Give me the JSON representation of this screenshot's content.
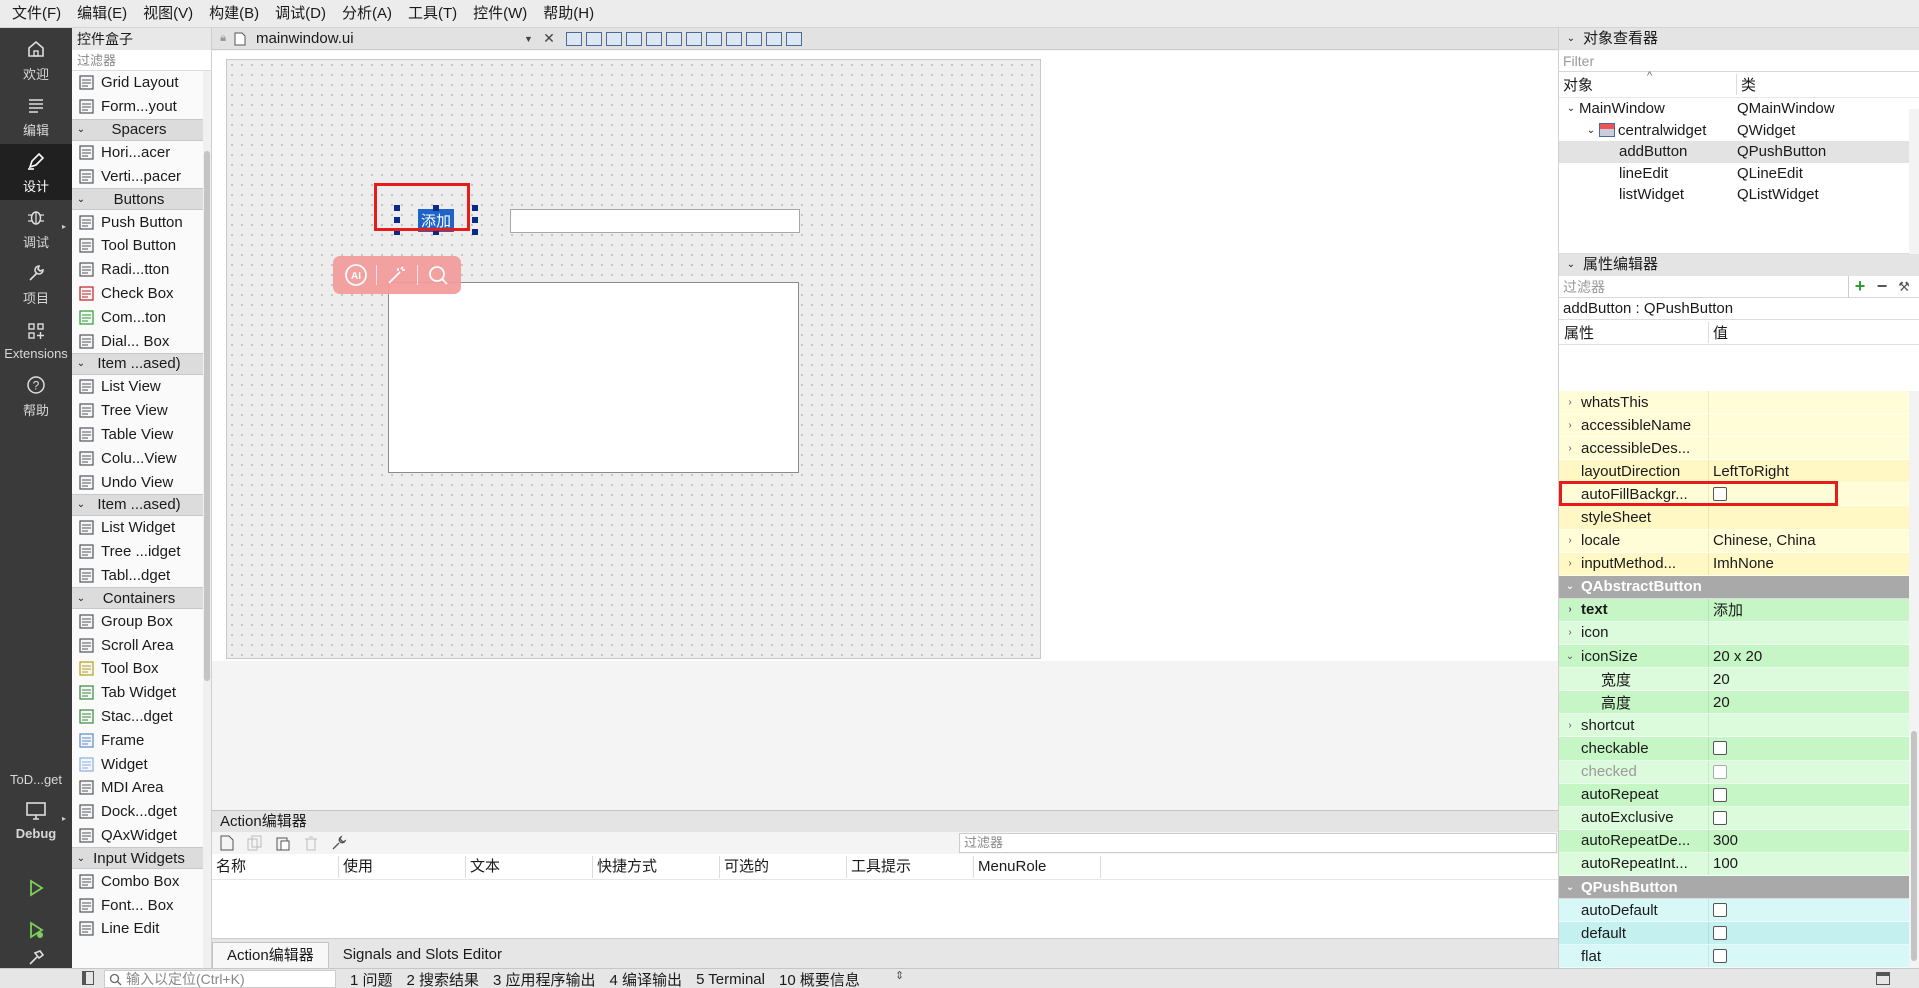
{
  "menu": [
    "文件(F)",
    "编辑(E)",
    "视图(V)",
    "构建(B)",
    "调试(D)",
    "分析(A)",
    "工具(T)",
    "控件(W)",
    "帮助(H)"
  ],
  "modes": {
    "welcome": "欢迎",
    "edit": "编辑",
    "design": "设计",
    "debug": "调试",
    "project": "项目",
    "extensions": "Extensions",
    "help": "帮助",
    "target_name": "ToD...get",
    "target_mode": "Debug"
  },
  "widgetbox": {
    "title": "控件盒子",
    "filter_placeholder": "过滤器",
    "items": [
      {
        "type": "item",
        "label": "Grid Layout",
        "icon": "grid-layout-icon"
      },
      {
        "type": "item",
        "label": "Form...yout",
        "icon": "form-layout-icon"
      },
      {
        "type": "cat",
        "label": "Spacers"
      },
      {
        "type": "item",
        "label": "Hori...acer",
        "icon": "horizontal-spacer-icon"
      },
      {
        "type": "item",
        "label": "Verti...pacer",
        "icon": "vertical-spacer-icon"
      },
      {
        "type": "cat",
        "label": "Buttons"
      },
      {
        "type": "item",
        "label": "Push Button",
        "icon": "push-button-icon"
      },
      {
        "type": "item",
        "label": "Tool Button",
        "icon": "tool-button-icon"
      },
      {
        "type": "item",
        "label": "Radi...tton",
        "icon": "radio-button-icon"
      },
      {
        "type": "item",
        "label": "Check Box",
        "icon": "check-box-icon"
      },
      {
        "type": "item",
        "label": "Com...ton",
        "icon": "command-link-icon"
      },
      {
        "type": "item",
        "label": "Dial... Box",
        "icon": "dialog-button-box-icon"
      },
      {
        "type": "cat",
        "label": "Item ...ased)"
      },
      {
        "type": "item",
        "label": "List View",
        "icon": "list-view-icon"
      },
      {
        "type": "item",
        "label": "Tree View",
        "icon": "tree-view-icon"
      },
      {
        "type": "item",
        "label": "Table View",
        "icon": "table-view-icon"
      },
      {
        "type": "item",
        "label": "Colu...View",
        "icon": "column-view-icon"
      },
      {
        "type": "item",
        "label": "Undo View",
        "icon": "undo-view-icon"
      },
      {
        "type": "cat",
        "label": "Item ...ased)"
      },
      {
        "type": "item",
        "label": "List Widget",
        "icon": "list-widget-icon"
      },
      {
        "type": "item",
        "label": "Tree ...idget",
        "icon": "tree-widget-icon"
      },
      {
        "type": "item",
        "label": "Tabl...dget",
        "icon": "table-widget-icon"
      },
      {
        "type": "cat",
        "label": "Containers"
      },
      {
        "type": "item",
        "label": "Group Box",
        "icon": "group-box-icon"
      },
      {
        "type": "item",
        "label": "Scroll Area",
        "icon": "scroll-area-icon"
      },
      {
        "type": "item",
        "label": "Tool Box",
        "icon": "tool-box-icon"
      },
      {
        "type": "item",
        "label": "Tab Widget",
        "icon": "tab-widget-icon"
      },
      {
        "type": "item",
        "label": "Stac...dget",
        "icon": "stacked-widget-icon"
      },
      {
        "type": "item",
        "label": "Frame",
        "icon": "frame-icon"
      },
      {
        "type": "item",
        "label": "Widget",
        "icon": "widget-icon"
      },
      {
        "type": "item",
        "label": "MDI Area",
        "icon": "mdi-area-icon"
      },
      {
        "type": "item",
        "label": "Dock...dget",
        "icon": "dock-widget-icon"
      },
      {
        "type": "item",
        "label": "QAxWidget",
        "icon": "qaxwidget-icon"
      },
      {
        "type": "cat",
        "label": "Input Widgets"
      },
      {
        "type": "item",
        "label": "Combo Box",
        "icon": "combo-box-icon"
      },
      {
        "type": "item",
        "label": "Font... Box",
        "icon": "font-combo-box-icon"
      },
      {
        "type": "item",
        "label": "Line Edit",
        "icon": "line-edit-icon"
      }
    ]
  },
  "editor": {
    "file_name": "mainwindow.ui",
    "form": {
      "button_text": "添加"
    }
  },
  "action_editor": {
    "title": "Action编辑器",
    "filter_placeholder": "过滤器",
    "columns": [
      "名称",
      "使用",
      "文本",
      "快捷方式",
      "可选的",
      "工具提示",
      "MenuRole"
    ],
    "tabs": [
      "Action编辑器",
      "Signals and Slots Editor"
    ]
  },
  "object_inspector": {
    "title": "对象查看器",
    "filter_placeholder": "Filter",
    "col_object": "对象",
    "col_class": "类",
    "rows": [
      {
        "name": "MainWindow",
        "cls": "QMainWindow",
        "depth": 0,
        "expand": "v"
      },
      {
        "name": "centralwidget",
        "cls": "QWidget",
        "depth": 1,
        "expand": "v"
      },
      {
        "name": "addButton",
        "cls": "QPushButton",
        "depth": 2,
        "expand": "",
        "selected": true
      },
      {
        "name": "lineEdit",
        "cls": "QLineEdit",
        "depth": 2,
        "expand": ""
      },
      {
        "name": "listWidget",
        "cls": "QListWidget",
        "depth": 2,
        "expand": ""
      }
    ]
  },
  "property_editor": {
    "title": "属性编辑器",
    "filter_placeholder": "过滤器",
    "object_class": "addButton : QPushButton",
    "col_property": "属性",
    "col_value": "值",
    "rows": [
      {
        "name": "whatsThis",
        "value": "",
        "expand": ">",
        "color": "#fffdd8"
      },
      {
        "name": "accessibleName",
        "value": "",
        "expand": ">",
        "color": "#fffdd8"
      },
      {
        "name": "accessibleDes...",
        "value": "",
        "expand": ">",
        "color": "#fffdd8"
      },
      {
        "name": "layoutDirection",
        "value": "LeftToRight",
        "expand": "",
        "color": "#fff8c4"
      },
      {
        "name": "autoFillBackgr...",
        "value": "",
        "checkbox": true,
        "expand": "",
        "color": "#fffdd8"
      },
      {
        "name": "styleSheet",
        "value": "",
        "expand": "",
        "color": "#fff8c4"
      },
      {
        "name": "locale",
        "value": "Chinese, China",
        "expand": ">",
        "color": "#fffdd8"
      },
      {
        "name": "inputMethod...",
        "value": "ImhNone",
        "expand": ">",
        "color": "#fff8c4"
      },
      {
        "name": "QAbstractButton",
        "section": true
      },
      {
        "name": "text",
        "value": "添加",
        "expand": ">",
        "bold": true,
        "color": "#c6f5c6"
      },
      {
        "name": "icon",
        "value": "",
        "expand": ">",
        "color": "#dcfbdc"
      },
      {
        "name": "iconSize",
        "value": "20 x 20",
        "expand": "v",
        "color": "#c6f5c6"
      },
      {
        "name": "宽度",
        "value": "20",
        "expand": "",
        "indent": true,
        "color": "#dcfbdc"
      },
      {
        "name": "高度",
        "value": "20",
        "expand": "",
        "indent": true,
        "color": "#c6f5c6"
      },
      {
        "name": "shortcut",
        "value": "",
        "expand": ">",
        "color": "#dcfbdc"
      },
      {
        "name": "checkable",
        "value": "",
        "checkbox": true,
        "expand": "",
        "color": "#c6f5c6"
      },
      {
        "name": "checked",
        "value": "",
        "checkbox": true,
        "dim": true,
        "expand": "",
        "color": "#dcfbdc"
      },
      {
        "name": "autoRepeat",
        "value": "",
        "checkbox": true,
        "expand": "",
        "color": "#c6f5c6"
      },
      {
        "name": "autoExclusive",
        "value": "",
        "checkbox": true,
        "expand": "",
        "color": "#dcfbdc"
      },
      {
        "name": "autoRepeatDe...",
        "value": "300",
        "expand": "",
        "color": "#c6f5c6"
      },
      {
        "name": "autoRepeatInt...",
        "value": "100",
        "expand": "",
        "color": "#dcfbdc"
      },
      {
        "name": "QPushButton",
        "section": true
      },
      {
        "name": "autoDefault",
        "value": "",
        "checkbox": true,
        "expand": "",
        "color": "#d8f7f7"
      },
      {
        "name": "default",
        "value": "",
        "checkbox": true,
        "expand": "",
        "color": "#c4f0f0"
      },
      {
        "name": "flat",
        "value": "",
        "checkbox": true,
        "expand": "",
        "color": "#d8f7f7"
      }
    ]
  },
  "statusbar": {
    "search_placeholder": "输入以定位(Ctrl+K)",
    "tabs": [
      "1 问题",
      "2 搜索结果",
      "3 应用程序输出",
      "4 编译输出",
      "5 Terminal",
      "10 概要信息"
    ]
  },
  "colors": {
    "highlight_red": "#e81b1b",
    "selection_blue": "#1e64c8",
    "modebar": "#3a3a3a"
  }
}
